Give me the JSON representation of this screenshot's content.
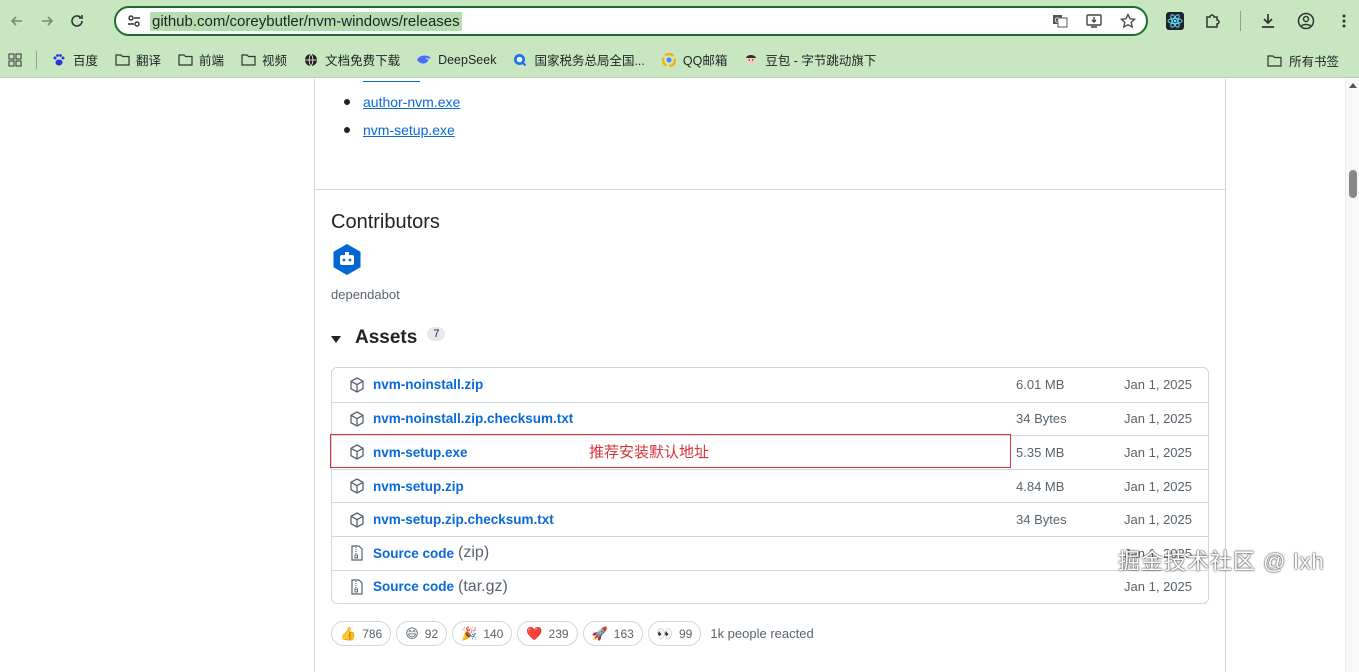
{
  "browser": {
    "url": "github.com/coreybutler/nvm-windows/releases",
    "icons": {
      "back": "arrow-left-icon",
      "forward": "arrow-right-icon",
      "reload": "reload-icon",
      "site_info": "tune-icon",
      "translate": "translate-icon",
      "install": "install-app-icon",
      "bookmark": "star-icon",
      "react_ext": "react-icon",
      "extensions": "puzzle-icon",
      "downloads": "download-icon",
      "profile": "profile-icon",
      "menu": "kebab-menu-icon",
      "apps": "apps-grid-icon",
      "folder": "folder-icon"
    }
  },
  "bookmarks": {
    "items": [
      {
        "label": "百度",
        "icon": "paw-icon"
      },
      {
        "label": "翻译",
        "icon": "folder-icon"
      },
      {
        "label": "前端",
        "icon": "folder-icon"
      },
      {
        "label": "视频",
        "icon": "folder-icon"
      },
      {
        "label": "文档免费下载",
        "icon": "globe-icon"
      },
      {
        "label": "DeepSeek",
        "icon": "deepseek-icon"
      },
      {
        "label": "国家税务总局全国...",
        "icon": "search-q-icon"
      },
      {
        "label": "QQ邮箱",
        "icon": "qq-mail-icon"
      },
      {
        "label": "豆包 - 字节跳动旗下",
        "icon": "doubao-icon"
      }
    ],
    "all_bookmarks": "所有书签"
  },
  "page": {
    "top_links": [
      "author-nvm.exe",
      "nvm-setup.exe"
    ],
    "contributors_title": "Contributors",
    "contributor_name": "dependabot",
    "assets_title": "Assets",
    "assets_count": "7",
    "assets": [
      {
        "name": "nvm-noinstall.zip",
        "suffix": "",
        "size": "6.01 MB",
        "date": "Jan 1, 2025",
        "icon": "package-icon"
      },
      {
        "name": "nvm-noinstall.zip.checksum.txt",
        "suffix": "",
        "size": "34 Bytes",
        "date": "Jan 1, 2025",
        "icon": "package-icon"
      },
      {
        "name": "nvm-setup.exe",
        "suffix": "",
        "size": "5.35 MB",
        "date": "Jan 1, 2025",
        "icon": "package-icon"
      },
      {
        "name": "nvm-setup.zip",
        "suffix": "",
        "size": "4.84 MB",
        "date": "Jan 1, 2025",
        "icon": "package-icon"
      },
      {
        "name": "nvm-setup.zip.checksum.txt",
        "suffix": "",
        "size": "34 Bytes",
        "date": "Jan 1, 2025",
        "icon": "package-icon"
      },
      {
        "name": "Source code",
        "suffix": "(zip)",
        "size": "",
        "date": "Jan 1, 2025",
        "icon": "file-zip-icon"
      },
      {
        "name": "Source code",
        "suffix": "(tar.gz)",
        "size": "",
        "date": "Jan 1, 2025",
        "icon": "file-zip-icon"
      }
    ],
    "annotation": "推荐安装默认地址",
    "reactions": [
      {
        "emoji": "👍",
        "count": "786",
        "icon": "thumbs-up-icon"
      },
      {
        "emoji": "😄",
        "count": "92",
        "icon": "laugh-icon"
      },
      {
        "emoji": "🎉",
        "count": "140",
        "icon": "hooray-icon"
      },
      {
        "emoji": "❤️",
        "count": "239",
        "icon": "heart-icon"
      },
      {
        "emoji": "🚀",
        "count": "163",
        "icon": "rocket-icon"
      },
      {
        "emoji": "👀",
        "count": "99",
        "icon": "eyes-icon"
      }
    ],
    "people_reacted": "1k people reacted"
  },
  "watermark": "掘金技术社区 @ lxh"
}
